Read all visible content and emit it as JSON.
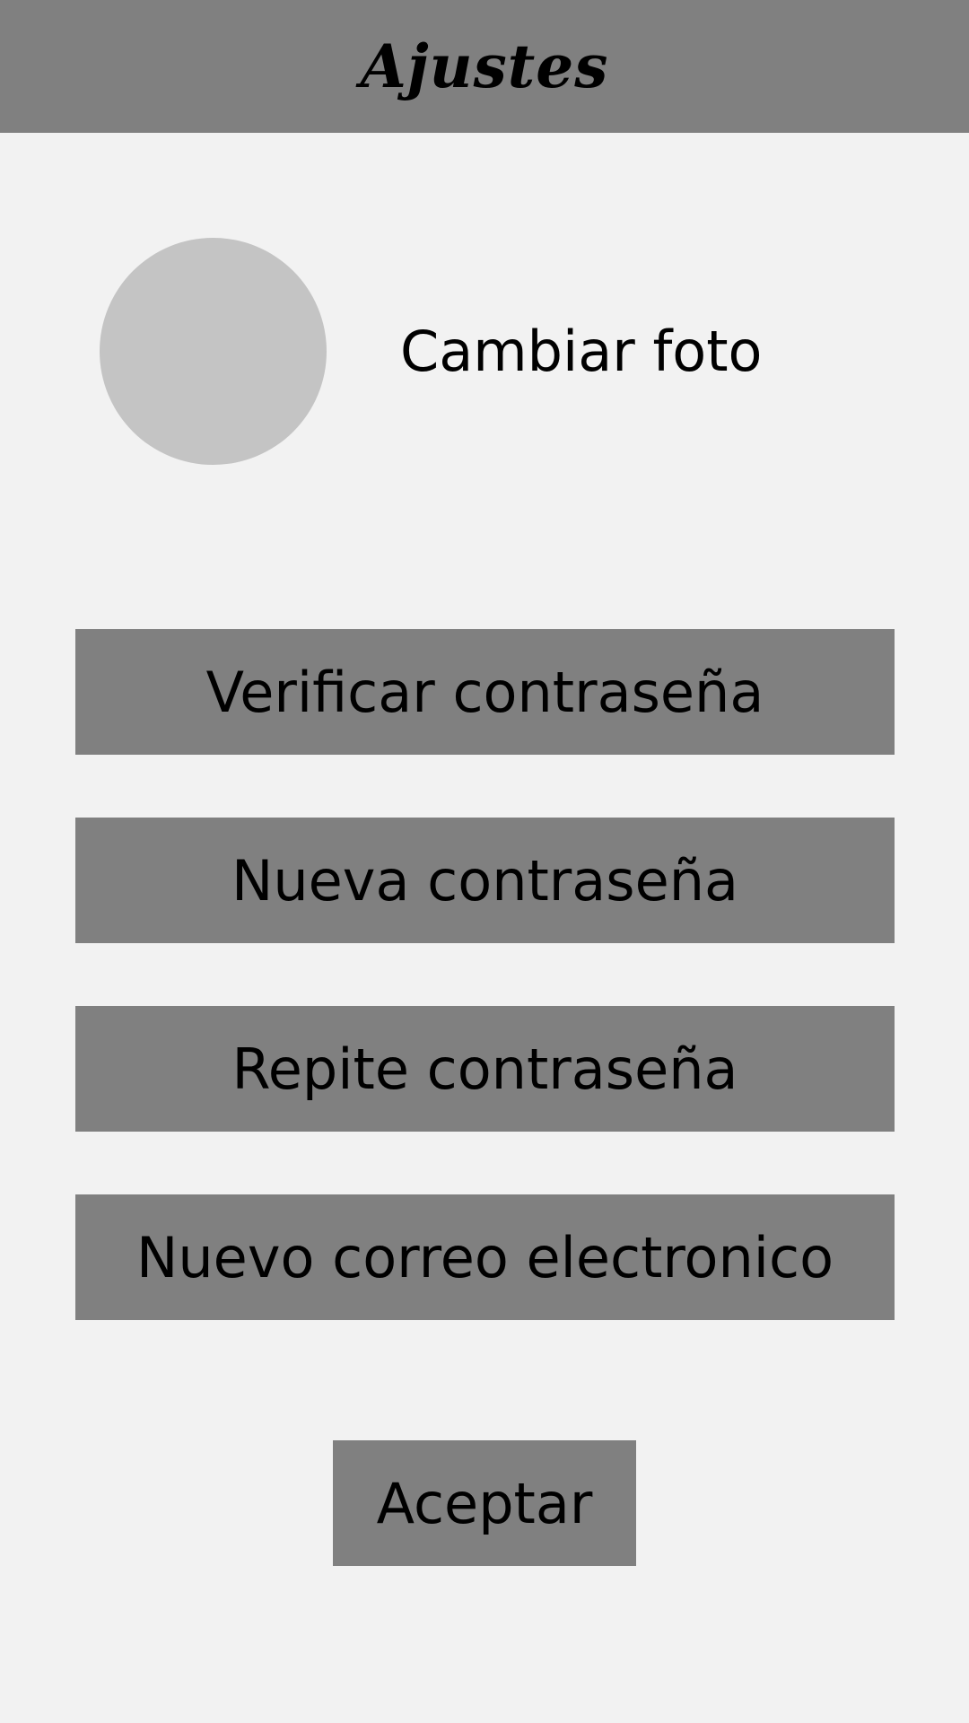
{
  "header": {
    "title": "Ajustes"
  },
  "profile": {
    "change_photo_label": "Cambiar foto"
  },
  "buttons": [
    {
      "label": "Verificar contraseña"
    },
    {
      "label": "Nueva contraseña"
    },
    {
      "label": "Repite contraseña"
    },
    {
      "label": "Nuevo correo electronico"
    }
  ],
  "accept": {
    "label": "Aceptar"
  },
  "colors": {
    "background": "#f2f2f2",
    "bar": "#808080",
    "avatar": "#c4c4c4",
    "text": "#000000"
  }
}
